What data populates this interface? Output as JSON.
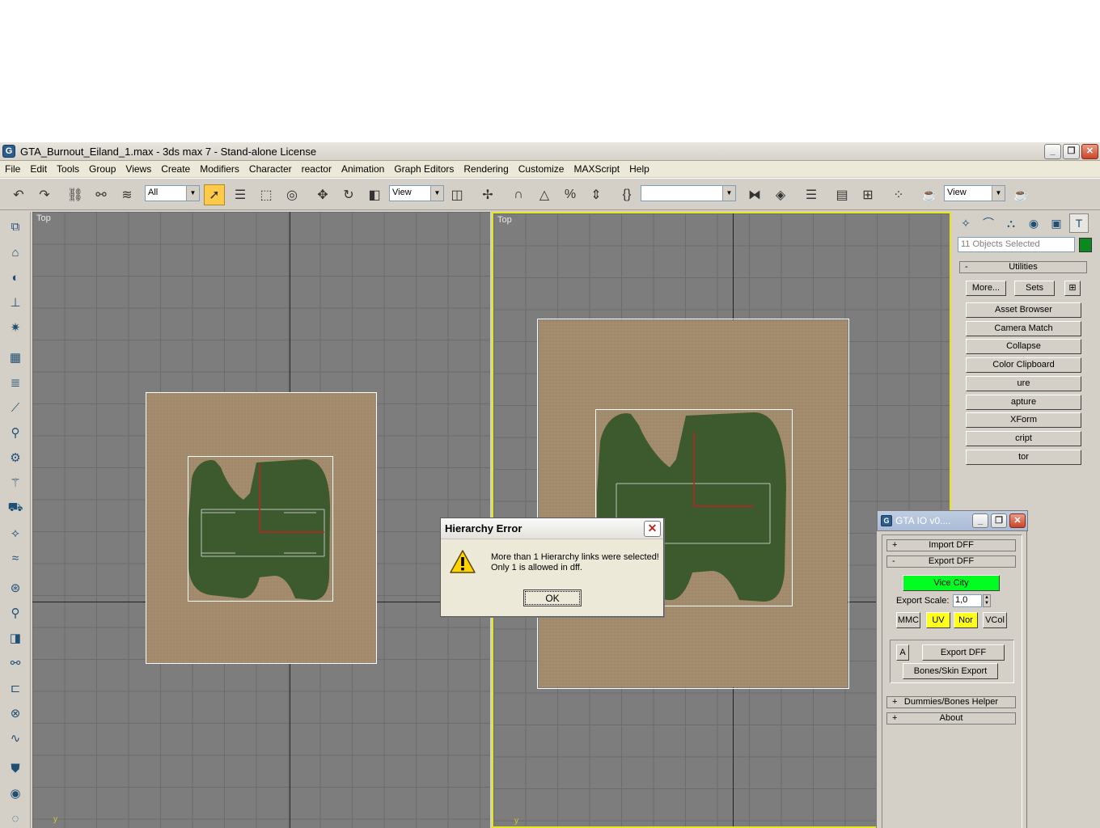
{
  "window": {
    "title": "GTA_Burnout_Eiland_1.max - 3ds max 7  - Stand-alone License",
    "min": "_",
    "max": "❐",
    "close": "✕"
  },
  "menu": [
    "File",
    "Edit",
    "Tools",
    "Group",
    "Views",
    "Create",
    "Modifiers",
    "Character",
    "reactor",
    "Animation",
    "Graph Editors",
    "Rendering",
    "Customize",
    "MAXScript",
    "Help"
  ],
  "toolbar": {
    "selection_filter": "All",
    "ref_coord": "View",
    "named_selection": "",
    "render_view": "View"
  },
  "viewports": {
    "left": {
      "label": "Top",
      "axis": "y"
    },
    "right": {
      "label": "Top",
      "axis": "y"
    }
  },
  "command_panel": {
    "selection_text": "11 Objects Selected",
    "selection_color": "#0a8a1e",
    "utilities_rollout": "Utilities",
    "rollout_toggle": "-",
    "more_button": "More...",
    "sets_button": "Sets",
    "utility_buttons": [
      "Asset Browser",
      "Camera Match",
      "Collapse",
      "Color Clipboard",
      "ure",
      "apture",
      "XForm",
      "cript",
      "tor"
    ]
  },
  "gta_io": {
    "title": "GTA IO v0....",
    "import_rollout": "Import DFF",
    "export_rollout": "Export DFF",
    "plus": "+",
    "minus": "-",
    "game_button": "Vice City",
    "export_scale_label": "Export Scale:",
    "export_scale_value": "1,0",
    "mmc": "MMC",
    "uv": "UV",
    "nor": "Nor",
    "vcol": "VCol",
    "a": "A",
    "export_button": "Export DFF",
    "bones_skin_export": "Bones/Skin Export",
    "dummies_rollout": "Dummies/Bones Helper",
    "about_rollout": "About"
  },
  "dialog": {
    "title": "Hierarchy Error",
    "message_line1": "More than 1 Hierarchy links were selected!",
    "message_line2": "Only 1 is allowed in dff.",
    "ok": "OK",
    "close": "✕"
  }
}
